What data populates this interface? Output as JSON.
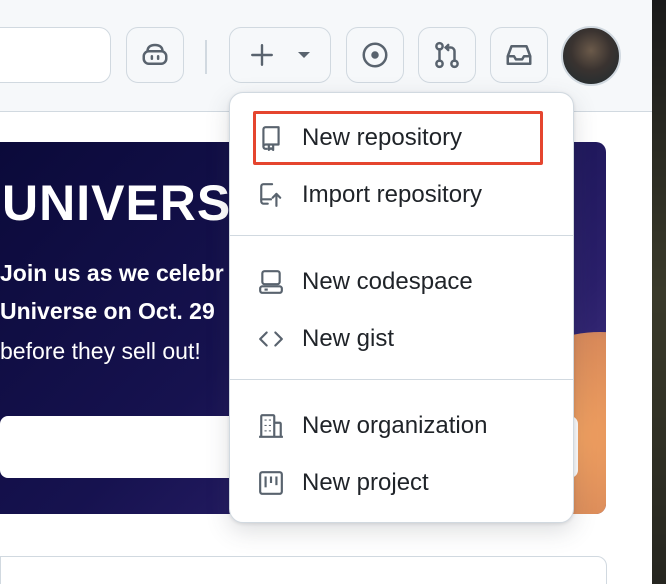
{
  "header": {
    "search_placeholder": "",
    "buttons": {
      "copilot_icon": "copilot-icon",
      "create_plus_icon": "plus-icon",
      "create_caret_icon": "triangle-down-icon",
      "issues_icon": "issue-opened-icon",
      "pulls_icon": "git-pull-request-icon",
      "inbox_icon": "inbox-icon"
    }
  },
  "banner": {
    "title": "UNIVERS",
    "line1": "Join us as we celebr",
    "line2": "Universe on Oct. 29",
    "line3": "before they sell out!"
  },
  "create_menu": {
    "items": [
      {
        "label": "New repository",
        "icon": "repo-icon"
      },
      {
        "label": "Import repository",
        "icon": "repo-push-icon"
      },
      {
        "label": "New codespace",
        "icon": "codespaces-icon"
      },
      {
        "label": "New gist",
        "icon": "code-icon"
      },
      {
        "label": "New organization",
        "icon": "organization-icon"
      },
      {
        "label": "New project",
        "icon": "project-icon"
      }
    ],
    "highlighted_item": "New repository",
    "highlight_color": "#e5452f"
  },
  "colors": {
    "header_bg": "#f6f8fa",
    "border": "#d1d9e0",
    "text": "#1f2328",
    "banner_bg": "#0b0a3a"
  }
}
